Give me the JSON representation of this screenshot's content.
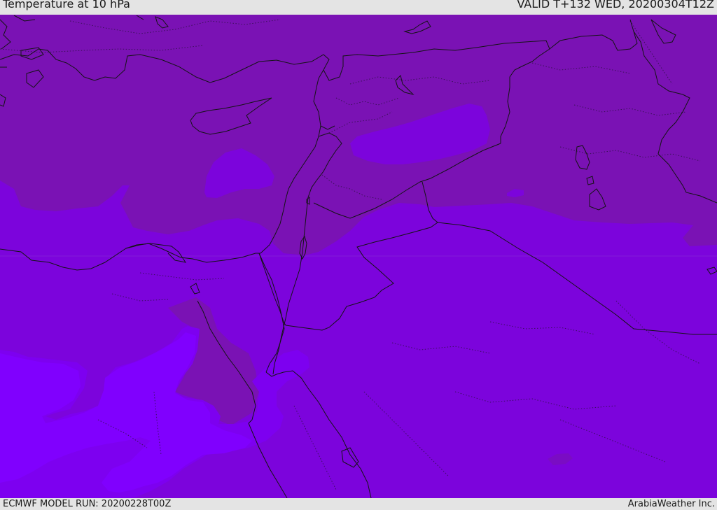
{
  "header": {
    "title": "Temperature at 10 hPa",
    "valid": "VALID T+132 WED, 20200304T12Z"
  },
  "footer": {
    "model_run": "ECMWF MODEL RUN: 20200228T00Z",
    "credit": "ArabiaWeather Inc."
  },
  "map": {
    "field_colors": {
      "darkest": "#7a12b4",
      "mid": "#7c04dc",
      "light": "#7d00f0",
      "lightest": "#8000fe"
    },
    "outline_color": "#141414"
  }
}
